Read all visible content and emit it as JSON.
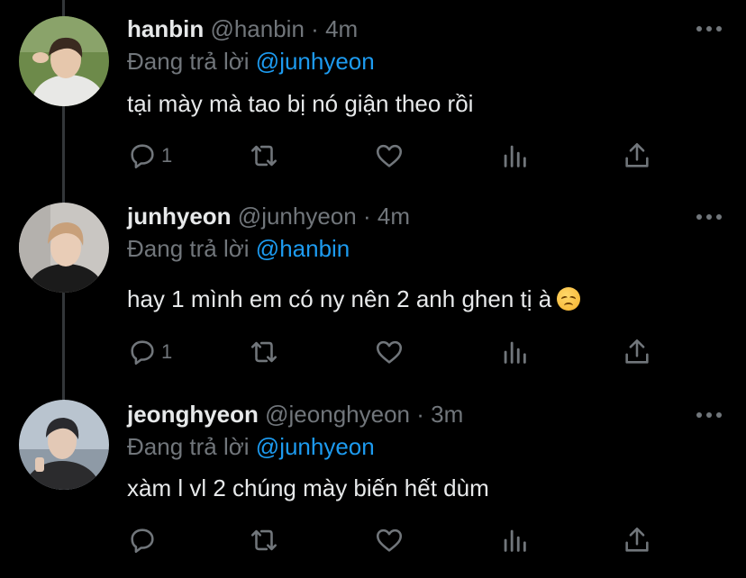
{
  "tweets": [
    {
      "name": "hanbin",
      "handle": "@hanbin",
      "dot": "·",
      "time": "4m",
      "reply_prefix": "Đang trả lời",
      "reply_to": "@junhyeon",
      "text": "tại mày mà tao bị nó giận theo rồi",
      "reply_count": "1",
      "avatar_colors": {
        "bg": "#6d8a4a",
        "skin": "#e6c7ac",
        "hair": "#3a2a20",
        "shirt": "#e8e8e6"
      }
    },
    {
      "name": "junhyeon",
      "handle": "@junhyeon",
      "dot": "·",
      "time": "4m",
      "reply_prefix": "Đang trả lời",
      "reply_to": "@hanbin",
      "text": "hay 1 mình em có ny nên 2 anh ghen tị à",
      "emoji": "disappointed-face",
      "reply_count": "1",
      "avatar_colors": {
        "bg": "#c9c6c2",
        "skin": "#e9cdb7",
        "hair": "#c8a07a",
        "shirt": "#1b1b1b"
      }
    },
    {
      "name": "jeonghyeon",
      "handle": "@jeonghyeon",
      "dot": "·",
      "time": "3m",
      "reply_prefix": "Đang trả lời",
      "reply_to": "@junhyeon",
      "text": "xàm l vl 2 chúng mày biến hết dùm",
      "reply_count": "",
      "avatar_colors": {
        "bg": "#b9c4cf",
        "skin": "#e3c9b6",
        "hair": "#2a2a2e",
        "shirt": "#2b2b2d"
      }
    }
  ],
  "icons": [
    "reply-icon",
    "retweet-icon",
    "like-icon",
    "analytics-icon",
    "share-icon",
    "more-icon"
  ],
  "colors": {
    "background": "#000000",
    "text": "#e7e9ea",
    "muted": "#71767b",
    "link": "#1d9bf0",
    "thread_line": "#333639"
  }
}
